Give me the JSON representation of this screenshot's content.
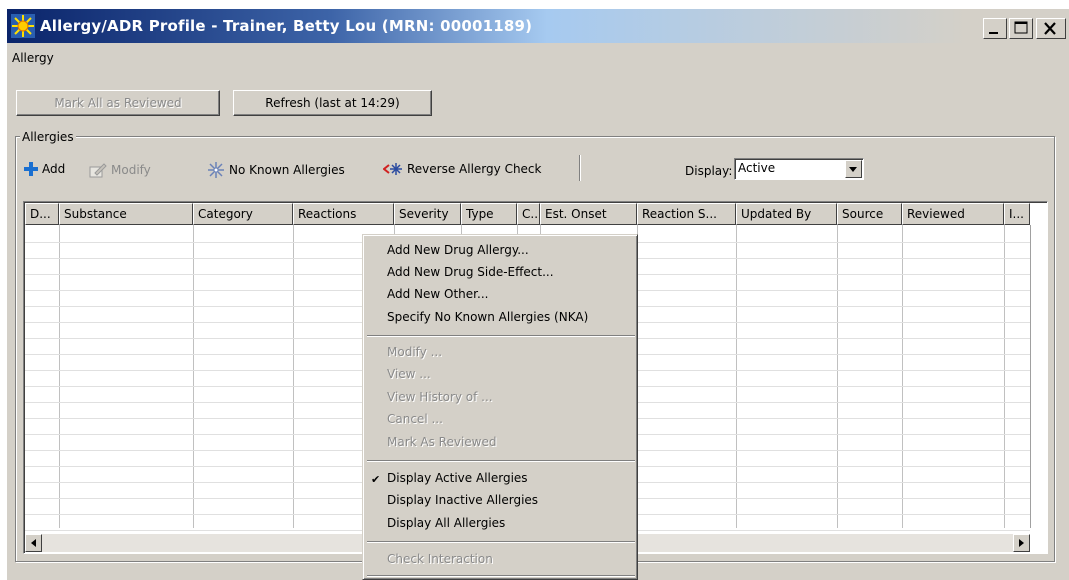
{
  "window": {
    "title": "Allergy/ADR Profile - Trainer, Betty Lou (MRN: 00001189)",
    "controls": [
      "minimize",
      "maximize",
      "close"
    ]
  },
  "menubar": {
    "items": [
      "Allergy"
    ]
  },
  "actions": {
    "mark_all_reviewed": "Mark All as Reviewed",
    "refresh": "Refresh (last at 14:29)"
  },
  "allergies": {
    "group_label": "Allergies",
    "toolbar": {
      "add": "Add",
      "modify": "Modify",
      "no_known": "No Known Allergies",
      "reverse_check": "Reverse Allergy Check"
    },
    "display_label": "Display:",
    "display_value": "Active",
    "columns": [
      "D...",
      "Substance",
      "Category",
      "Reactions",
      "Severity",
      "Type",
      "C...",
      "Est. Onset",
      "Reaction S...",
      "Updated By",
      "Source",
      "Reviewed",
      "I..."
    ],
    "rows": []
  },
  "context_menu": {
    "group1": [
      "Add New Drug Allergy...",
      "Add New Drug Side-Effect...",
      "Add New Other...",
      "Specify No Known Allergies (NKA)"
    ],
    "group2_disabled": [
      "Modify ...",
      "View ...",
      "View History of ...",
      "Cancel ...",
      "Mark As Reviewed"
    ],
    "group3": [
      "Display Active Allergies",
      "Display Inactive Allergies",
      "Display All Allergies"
    ],
    "checked_item": "Display Active Allergies",
    "group4_disabled": [
      "Check Interaction"
    ]
  },
  "colors": {
    "title_gradient_start": "#0a246a",
    "title_gradient_end": "#a6caf0",
    "face": "#d4d0c8",
    "disabled_text": "#8a8a8a"
  }
}
